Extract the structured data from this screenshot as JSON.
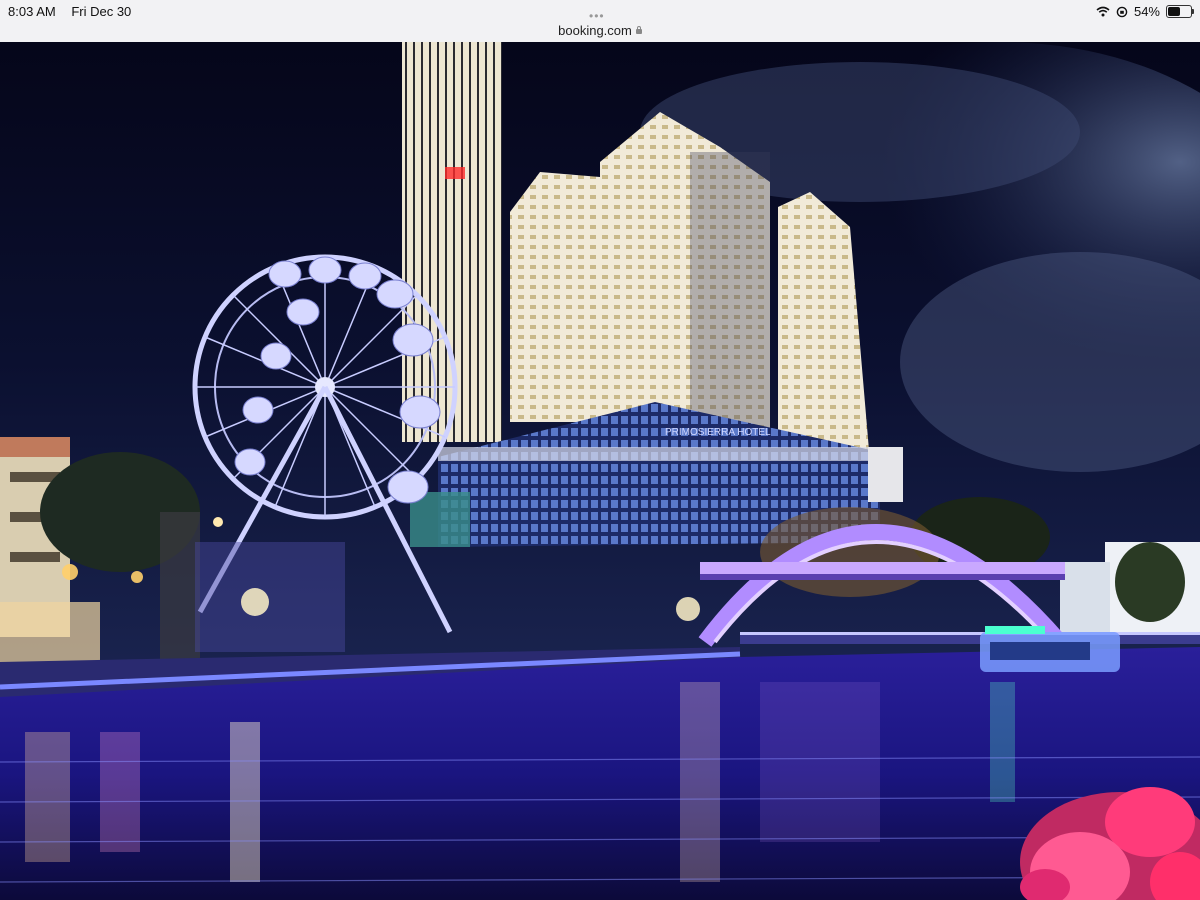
{
  "status_bar": {
    "time": "8:03 AM",
    "date": "Fri Dec 30",
    "url": "booking.com",
    "battery_text": "54%",
    "battery_level": 0.54,
    "icons": [
      "wifi-icon",
      "orientation-lock-icon",
      "battery-icon",
      "lock-icon"
    ]
  },
  "photo": {
    "building_sign": "PRIMOSIERRA HOTEL"
  },
  "colors": {
    "status_bar_bg": "#f2f2f4",
    "sky": "#070a1f",
    "water": "#1a1580",
    "neon_blue": "#5566ff",
    "bridge": "#b18cff",
    "flowers": "#ff3b7a"
  }
}
